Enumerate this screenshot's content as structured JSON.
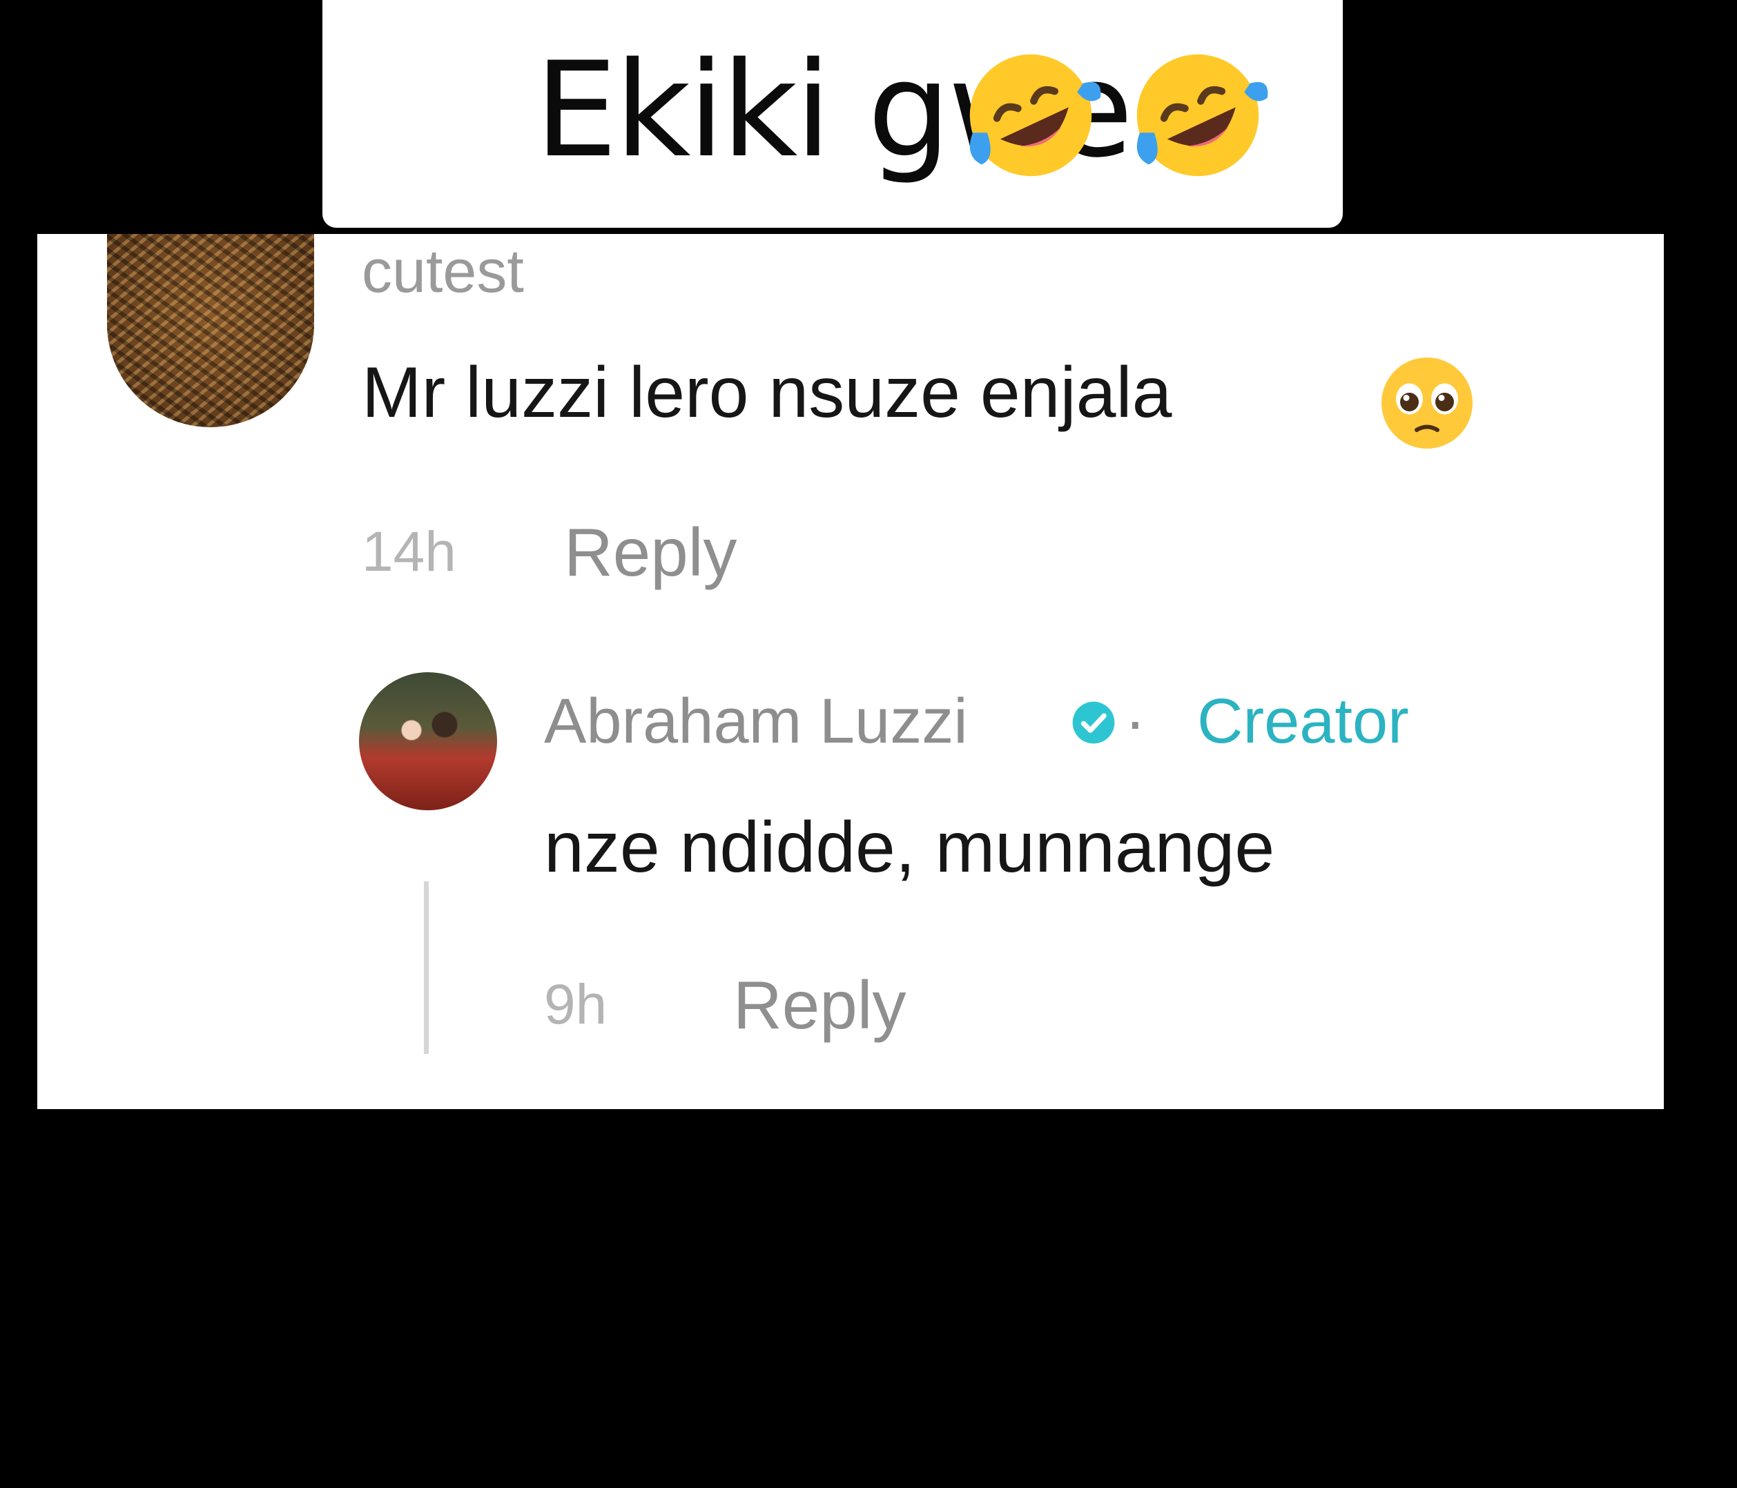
{
  "caption": {
    "text": "Ekiki gwe",
    "emoji": "rolling-on-floor-laughing",
    "emoji_count": 2
  },
  "comment": {
    "username": "cutest",
    "text": "Mr luzzi lero nsuze enjala",
    "emoji": "pleading-face",
    "time": "14h",
    "reply_label": "Reply"
  },
  "reply": {
    "username": "Abraham Luzzi",
    "separator": "·",
    "badge_label": "Creator",
    "text": "nze ndidde, munnange",
    "time": "9h",
    "reply_label": "Reply"
  },
  "colors": {
    "background": "#000000",
    "card": "#ffffff",
    "creator_accent": "#2bb3c2",
    "verified_badge": "#2ec5d3",
    "muted_text": "#9a9a9a"
  }
}
